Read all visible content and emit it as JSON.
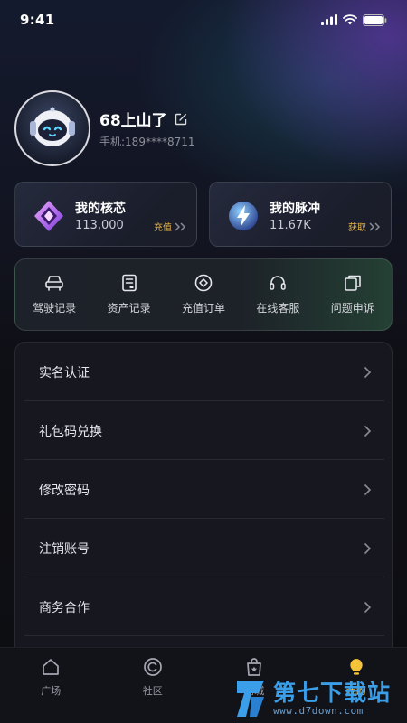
{
  "status_bar": {
    "time": "9:41"
  },
  "profile": {
    "username": "68上山了",
    "phone": "手机:189****8711"
  },
  "assets": [
    {
      "title": "我的核芯",
      "amount": "113,000",
      "action": "充值",
      "icon": "core-crystal-icon"
    },
    {
      "title": "我的脉冲",
      "amount": "11.67K",
      "action": "获取",
      "icon": "pulse-orb-icon"
    }
  ],
  "quick_actions": [
    {
      "label": "驾驶记录",
      "icon": "car-icon"
    },
    {
      "label": "资产记录",
      "icon": "document-icon"
    },
    {
      "label": "充值订单",
      "icon": "coin-icon"
    },
    {
      "label": "在线客服",
      "icon": "headset-icon"
    },
    {
      "label": "问题申诉",
      "icon": "copy-icon"
    }
  ],
  "menu": [
    {
      "label": "实名认证"
    },
    {
      "label": "礼包码兑换"
    },
    {
      "label": "修改密码"
    },
    {
      "label": "注销账号"
    },
    {
      "label": "商务合作"
    }
  ],
  "tabs": [
    {
      "label": "广场",
      "icon": "home-icon",
      "active": false
    },
    {
      "label": "社区",
      "icon": "community-icon",
      "active": false
    },
    {
      "label": "商城",
      "icon": "shop-icon",
      "active": false
    },
    {
      "label": "我的",
      "icon": "bulb-icon",
      "active": true
    }
  ],
  "watermark": {
    "title": "第七下载站",
    "url": "www.d7down.com"
  },
  "colors": {
    "accent": "#f3c33a",
    "action_text": "#e3b24a",
    "watermark": "#3b9ee8"
  }
}
